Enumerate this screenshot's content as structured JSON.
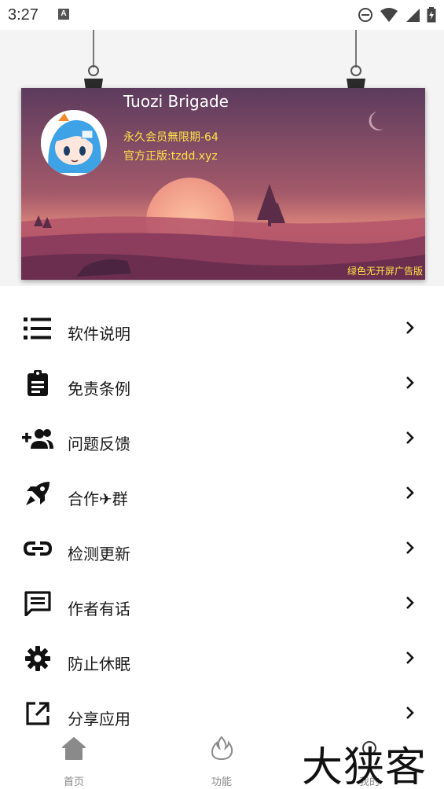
{
  "status_bar": {
    "time": "3:27",
    "notification_badge": "A"
  },
  "profile": {
    "name": "Tuozi Brigade",
    "membership": "永久会员無限期-64",
    "official": "官方正版:tzdd.xyz",
    "ad_note": "绿色无开屏广告版"
  },
  "menu": {
    "items": [
      {
        "label": "软件说明",
        "icon": "list-icon"
      },
      {
        "label": "免责条例",
        "icon": "clipboard-icon"
      },
      {
        "label": "问题反馈",
        "icon": "add-person-icon"
      },
      {
        "label": "合作✈群",
        "icon": "rocket-icon"
      },
      {
        "label": "检测更新",
        "icon": "link-icon"
      },
      {
        "label": "作者有话",
        "icon": "message-icon"
      },
      {
        "label": "防止休眠",
        "icon": "gear-icon"
      },
      {
        "label": "分享应用",
        "icon": "open-external-icon"
      }
    ]
  },
  "bottom_nav": {
    "tabs": [
      {
        "label": "首页",
        "icon": "home-icon"
      },
      {
        "label": "功能",
        "icon": "flame-icon"
      },
      {
        "label": "我的",
        "icon": "profile-icon"
      }
    ]
  },
  "watermark": "大狭客",
  "colors": {
    "card_top": "#5e3e5f",
    "card_bottom": "#c76e6e",
    "highlight_text": "#ffe34a",
    "icon": "#111111"
  }
}
